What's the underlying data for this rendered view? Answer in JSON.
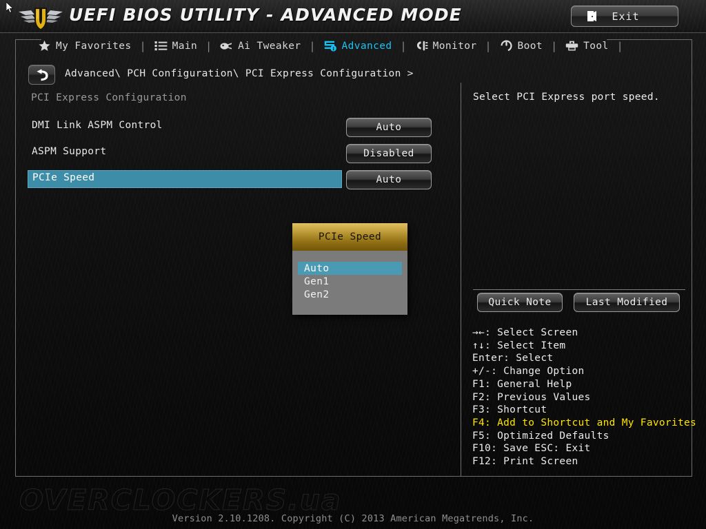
{
  "header": {
    "title": "UEFI BIOS UTILITY - ADVANCED MODE",
    "logo_icon": "tuf-shield-wings-logo",
    "cursor_icon": "mouse-pointer-cursor",
    "exit": {
      "label": "Exit",
      "icon": "exit-door-icon"
    }
  },
  "nav": {
    "separator": "|",
    "tabs": [
      {
        "label": "My Favorites",
        "icon": "star-icon",
        "active": false
      },
      {
        "label": "Main",
        "icon": "list-icon",
        "active": false
      },
      {
        "label": "Ai Tweaker",
        "icon": "tweaker-knob-icon",
        "active": false
      },
      {
        "label": "Advanced",
        "icon": "advanced-info-icon",
        "active": true
      },
      {
        "label": "Monitor",
        "icon": "thermometer-icon",
        "active": false
      },
      {
        "label": "Boot",
        "icon": "power-icon",
        "active": false
      },
      {
        "label": "Tool",
        "icon": "toolbox-icon",
        "active": false
      }
    ]
  },
  "breadcrumb": {
    "back_icon": "back-arrow-icon",
    "path": "Advanced\\ PCH Configuration\\ PCI Express Configuration >"
  },
  "main": {
    "section_title": "PCI Express Configuration",
    "rows": [
      {
        "label": "DMI Link ASPM Control",
        "value": "Auto",
        "selected": false
      },
      {
        "label": "ASPM Support",
        "value": "Disabled",
        "selected": false
      },
      {
        "label": "PCIe Speed",
        "value": "Auto",
        "selected": true
      }
    ]
  },
  "dropdown": {
    "title": "PCIe Speed",
    "options": [
      {
        "label": "Auto",
        "selected": true
      },
      {
        "label": "Gen1",
        "selected": false
      },
      {
        "label": "Gen2",
        "selected": false
      }
    ]
  },
  "help": {
    "text": "Select PCI Express port speed.",
    "quick_note_label": "Quick Note",
    "last_modified_label": "Last Modified",
    "shortcuts": [
      {
        "text": "→←: Select Screen",
        "highlight": false
      },
      {
        "text": "↑↓: Select Item",
        "highlight": false
      },
      {
        "text": "Enter: Select",
        "highlight": false
      },
      {
        "text": "+/-: Change Option",
        "highlight": false
      },
      {
        "text": "F1: General Help",
        "highlight": false
      },
      {
        "text": "F2: Previous Values",
        "highlight": false
      },
      {
        "text": "F3: Shortcut",
        "highlight": false
      },
      {
        "text": "F4: Add to Shortcut and My Favorites",
        "highlight": true
      },
      {
        "text": "F5: Optimized Defaults",
        "highlight": false
      },
      {
        "text": "F10: Save  ESC: Exit",
        "highlight": false
      },
      {
        "text": "F12: Print Screen",
        "highlight": false
      }
    ]
  },
  "footer": {
    "watermark": "OVERCLOCKERS.ua",
    "version": "Version 2.10.1208. Copyright (C) 2013 American Megatrends, Inc."
  },
  "colors": {
    "accent_cyan": "#17c4f5",
    "row_highlight": "#3d8da8",
    "dropdown_header_gold": "#c2a03c",
    "dropdown_body_gray": "#7b7b7b",
    "dropdown_selected": "#4a9ab4",
    "shortcut_highlight_yellow": "#ffe400"
  }
}
